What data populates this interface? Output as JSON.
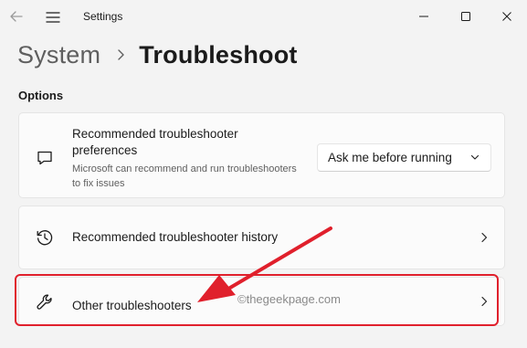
{
  "window": {
    "title": "Settings",
    "controls": {
      "minimize_icon": "minimize-icon",
      "maximize_icon": "maximize-icon",
      "close_icon": "close-icon"
    }
  },
  "breadcrumb": {
    "parent": "System",
    "current": "Troubleshoot"
  },
  "options": {
    "section_label": "Options",
    "items": [
      {
        "icon": "message-icon",
        "title": "Recommended troubleshooter preferences",
        "description": "Microsoft can recommend and run troubleshooters to fix issues",
        "dropdown_value": "Ask me before running"
      },
      {
        "icon": "history-icon",
        "title": "Recommended troubleshooter history"
      },
      {
        "icon": "wrench-icon",
        "title": "Other troubleshooters"
      }
    ]
  },
  "watermark": "©thegeekpage.com",
  "colors": {
    "highlight": "#e0202c",
    "background": "#f3f3f3",
    "card": "#fbfbfb"
  }
}
